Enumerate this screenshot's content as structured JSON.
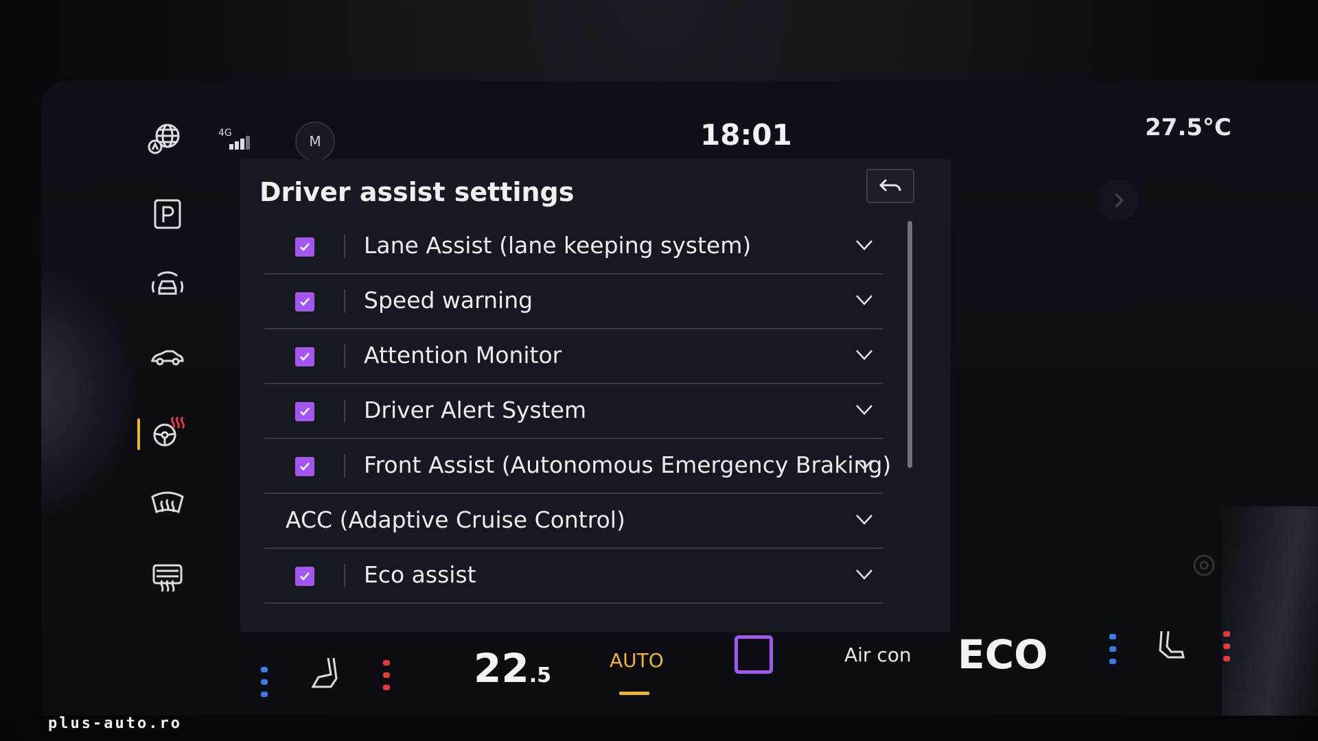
{
  "status_bar": {
    "network_label": "4G",
    "profile_initial": "M",
    "time": "18:01",
    "outside_temperature": "27.5°C"
  },
  "sidebar": {
    "items": [
      {
        "icon": "globe-location-icon"
      },
      {
        "icon": "parking-icon"
      },
      {
        "icon": "car-front-sensor-icon"
      },
      {
        "icon": "car-side-icon"
      },
      {
        "icon": "heated-steering-wheel-icon",
        "active": true
      },
      {
        "icon": "front-defrost-icon"
      },
      {
        "icon": "rear-defrost-icon"
      }
    ],
    "active_color": "#f0b52a"
  },
  "panel": {
    "title": "Driver assist settings",
    "back_icon": "back-arrow-icon",
    "rows": [
      {
        "label": "Lane Assist (lane keeping system)",
        "checked": true
      },
      {
        "label": "Speed warning",
        "checked": true
      },
      {
        "label": "Attention Monitor",
        "checked": true
      },
      {
        "label": "Driver Alert System",
        "checked": true
      },
      {
        "label": "Front Assist (Autonomous Emergency Braking)",
        "checked": true
      },
      {
        "label": "ACC (Adaptive Cruise Control)",
        "checked": null
      },
      {
        "label": "Eco assist",
        "checked": true
      }
    ],
    "checkbox_color": "#a257f0"
  },
  "climate": {
    "temperature_main": "22",
    "temperature_decimal": ".5",
    "auto_label": "AUTO",
    "aircon_label": "Air con",
    "eco_label": "ECO",
    "accent_color": "#f0b52a"
  },
  "watermark": "plus-auto.ro"
}
